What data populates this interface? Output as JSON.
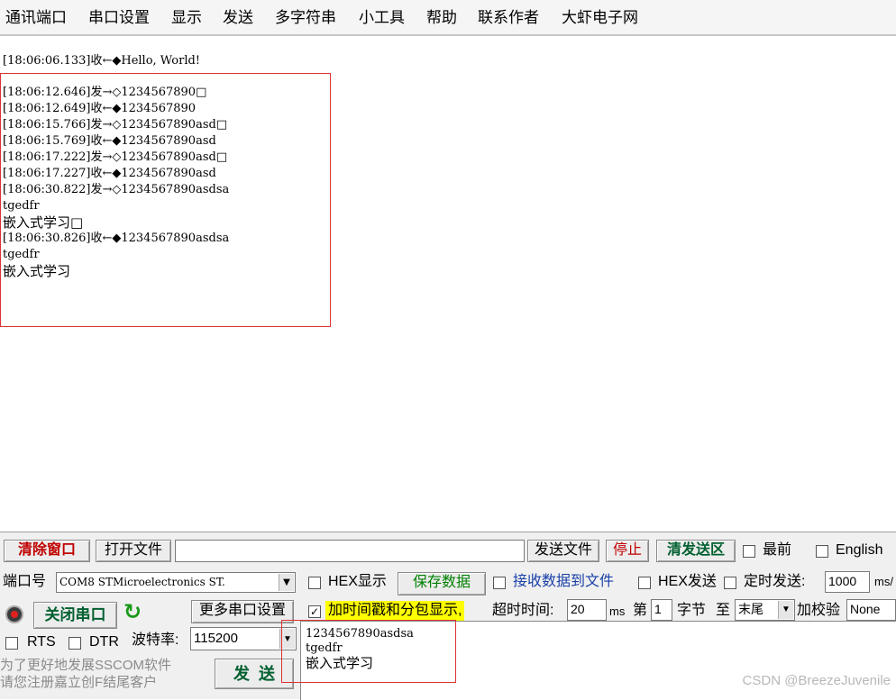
{
  "menu": [
    "通讯端口",
    "串口设置",
    "显示",
    "发送",
    "多字符串",
    "小工具",
    "帮助",
    "联系作者",
    "大虾电子网"
  ],
  "log": {
    "first_line": "[18:06:06.133]收←◆Hello, World!",
    "lines": [
      "[18:06:12.646]发→◇1234567890□",
      "[18:06:12.649]收←◆1234567890",
      "[18:06:15.766]发→◇1234567890asd□",
      "[18:06:15.769]收←◆1234567890asd",
      "[18:06:17.222]发→◇1234567890asd□",
      "[18:06:17.227]收←◆1234567890asd",
      "[18:06:30.822]发→◇1234567890asdsa",
      "tgedfr",
      "嵌入式学习□",
      "[18:06:30.826]收←◆1234567890asdsa",
      "tgedfr",
      "嵌入式学习"
    ]
  },
  "toolbar": {
    "clear_window": "清除窗口",
    "open_file": "打开文件",
    "file_path": "",
    "send_file": "发送文件",
    "stop": "停止",
    "clear_send": "清发送区",
    "topmost": "最前",
    "english": "English"
  },
  "row2": {
    "port_label": "端口号",
    "port_value": "COM8 STMicroelectronics ST.",
    "hex_display": "HEX显示",
    "save_data": "保存数据",
    "recv_to_file": "接收数据到文件",
    "hex_send": "HEX发送",
    "timed_send": "定时发送:",
    "timer_value": "1000",
    "timer_unit": "ms/"
  },
  "row3": {
    "close_port": "关闭串口",
    "more_settings": "更多串口设置",
    "timestamp": "加时间戳和分包显示,",
    "timeout_label": "超时时间:",
    "timeout_value": "20",
    "timeout_unit": "ms",
    "nth": "第",
    "byte_index": "1",
    "byte_label": "字节",
    "to": "至",
    "end_value": "末尾",
    "checksum_label": "加校验",
    "checksum_value": "None"
  },
  "row4": {
    "rts": "RTS",
    "dtr": "DTR",
    "baud_label": "波特率:",
    "baud_value": "115200"
  },
  "promo": [
    "为了更好地发展SSCOM软件",
    "请您注册嘉立创F结尾客户"
  ],
  "send_button": "发  送",
  "send_area": [
    "1234567890asdsa",
    "tgedfr",
    "嵌入式学习"
  ],
  "watermark": "CSDN @BreezeJuvenile"
}
